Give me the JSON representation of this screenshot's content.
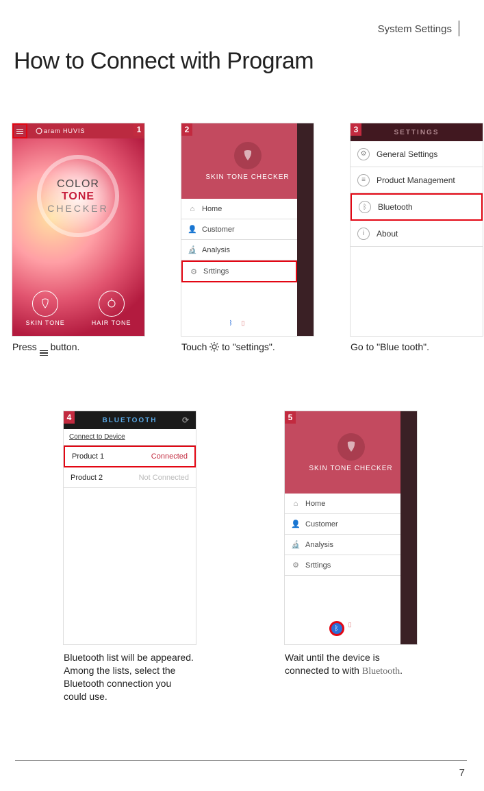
{
  "header": {
    "section": "System Settings"
  },
  "title": "How to Connect with Program",
  "page_number": "7",
  "step1": {
    "num": "1",
    "brand": "aram HUVIS",
    "logo_line1": "COLOR",
    "logo_line2": "TONE",
    "logo_line3": "CHECKER",
    "btn1": "SKIN TONE",
    "btn2": "HAIR TONE",
    "caption_pre": "Press ",
    "caption_post": " button."
  },
  "step2": {
    "num": "2",
    "header": "SKIN TONE CHECKER",
    "menu": [
      {
        "icon": "home-icon",
        "label": "Home"
      },
      {
        "icon": "person-icon",
        "label": "Customer"
      },
      {
        "icon": "microscope-icon",
        "label": "Analysis"
      },
      {
        "icon": "gear-icon",
        "label": "Srttings",
        "highlight": true
      }
    ],
    "caption_pre": "Touch ",
    "caption_post": " to \"settings\"."
  },
  "step3": {
    "num": "3",
    "header": "SETTINGS",
    "items": [
      {
        "icon": "gear-icon",
        "label": "General Settings"
      },
      {
        "icon": "list-icon",
        "label": "Product Management"
      },
      {
        "icon": "bluetooth-icon",
        "label": "Bluetooth",
        "highlight": true
      },
      {
        "icon": "info-icon",
        "label": "About"
      }
    ],
    "caption": "Go to \"Blue tooth\"."
  },
  "step4": {
    "num": "4",
    "header": "BLUETOOTH",
    "subhead": "Connect to Device",
    "rows": [
      {
        "name": "Product 1",
        "status": "Connected",
        "connected": true,
        "highlight": true
      },
      {
        "name": "Product 2",
        "status": "Not Connected",
        "connected": false
      }
    ],
    "caption": "Bluetooth list will be appeared. Among the lists, select the Bluetooth connection you could use."
  },
  "step5": {
    "num": "5",
    "header": "SKIN TONE CHECKER",
    "menu": [
      {
        "icon": "home-icon",
        "label": "Home"
      },
      {
        "icon": "person-icon",
        "label": "Customer"
      },
      {
        "icon": "microscope-icon",
        "label": "Analysis"
      },
      {
        "icon": "gear-icon",
        "label": "Srttings"
      }
    ],
    "caption_pre": "Wait until the device is connected to with ",
    "caption_bt": "Bluetooth",
    "caption_post": "."
  }
}
